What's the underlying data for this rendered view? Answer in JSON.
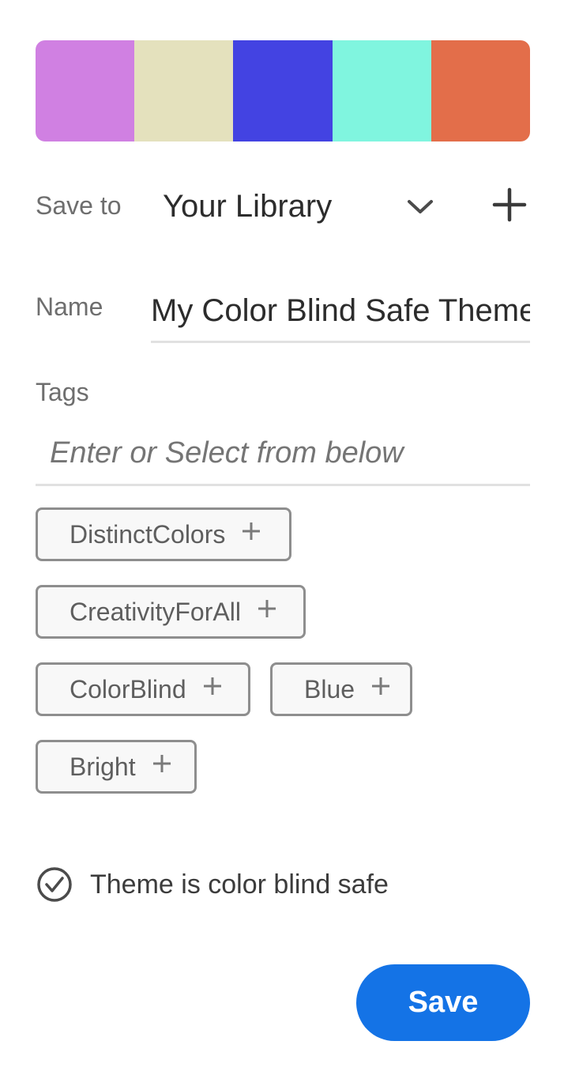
{
  "palette": {
    "swatches": [
      "#d080e2",
      "#e4e1bd",
      "#4343e2",
      "#80f5df",
      "#e36e4a"
    ]
  },
  "save_to": {
    "label": "Save to",
    "value": "Your Library",
    "dropdown_icon": "chevron-down-icon",
    "add_icon": "plus-icon"
  },
  "name": {
    "label": "Name",
    "value": "My Color Blind Safe Theme"
  },
  "tags": {
    "label": "Tags",
    "placeholder": "Enter or Select from below",
    "suggestions": [
      "DistinctColors",
      "CreativityForAll",
      "ColorBlind",
      "Blue",
      "Bright"
    ]
  },
  "color_blind_check": {
    "icon": "checkmark-circle-icon",
    "text": "Theme is color blind safe"
  },
  "save_button": {
    "label": "Save",
    "color": "#1473e6"
  }
}
